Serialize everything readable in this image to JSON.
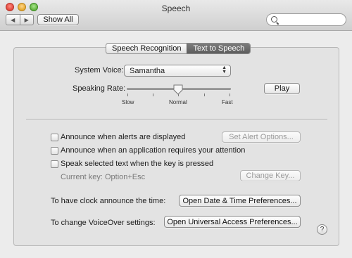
{
  "window": {
    "title": "Speech"
  },
  "toolbar": {
    "back_icon": "triangle-left-icon",
    "forward_icon": "triangle-right-icon",
    "show_all_label": "Show All",
    "search_placeholder": ""
  },
  "tabs": [
    {
      "label": "Speech Recognition",
      "active": false
    },
    {
      "label": "Text to Speech",
      "active": true
    }
  ],
  "voice": {
    "label": "System Voice:",
    "selected": "Samantha"
  },
  "rate": {
    "label": "Speaking Rate:",
    "play_label": "Play",
    "value": 0.5,
    "tick_slow": "Slow",
    "tick_normal": "Normal",
    "tick_fast": "Fast"
  },
  "options": {
    "announce_alerts": {
      "label": "Announce when alerts are displayed",
      "checked": false
    },
    "set_alert_options_label": "Set Alert Options...",
    "announce_attention": {
      "label": "Announce when an application requires your attention",
      "checked": false
    },
    "speak_selected": {
      "label": "Speak selected text when the key is pressed",
      "checked": false
    },
    "current_key_text": "Current key: Option+Esc",
    "change_key_label": "Change Key..."
  },
  "clock": {
    "label": "To have clock announce the time:",
    "button_label": "Open Date & Time Preferences..."
  },
  "voiceover": {
    "label": "To change VoiceOver settings:",
    "button_label": "Open Universal Access Preferences..."
  },
  "help": {
    "label": "?"
  }
}
